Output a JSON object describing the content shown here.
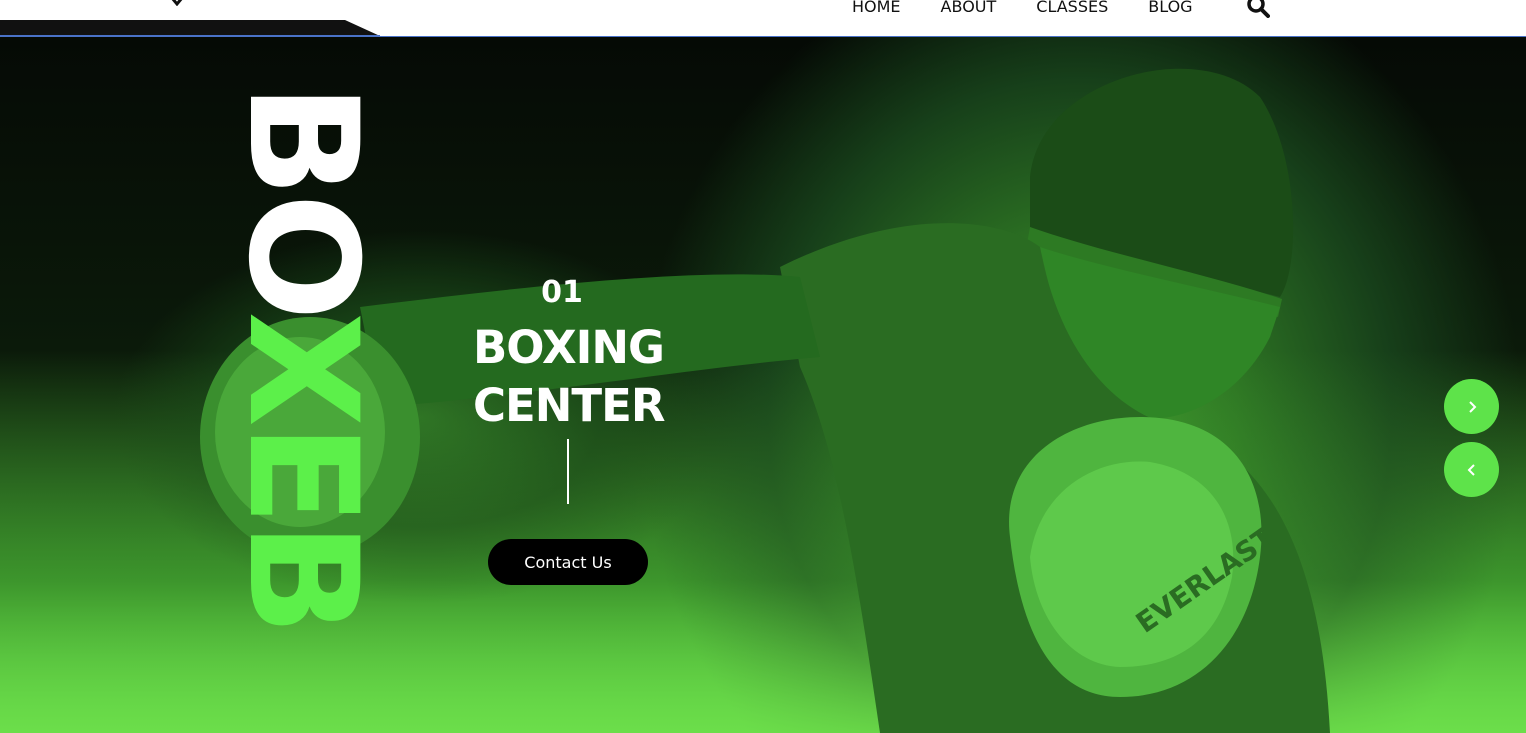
{
  "nav": {
    "items": [
      "HOME",
      "ABOUT",
      "CLASSES",
      "BLOG"
    ]
  },
  "icons": {
    "search": "search-icon",
    "next": "chevron-right-icon",
    "prev": "chevron-left-icon"
  },
  "hero": {
    "vertical_white": "BO",
    "vertical_green": "XEB",
    "slide_number": "01",
    "title_line1": "BOXING",
    "title_line2": "CENTER",
    "cta_label": "Contact Us",
    "glove_brand": "EVERLAST"
  },
  "colors": {
    "accent": "#5ee34a",
    "header_bg": "#ffffff",
    "button_bg": "#000000"
  }
}
